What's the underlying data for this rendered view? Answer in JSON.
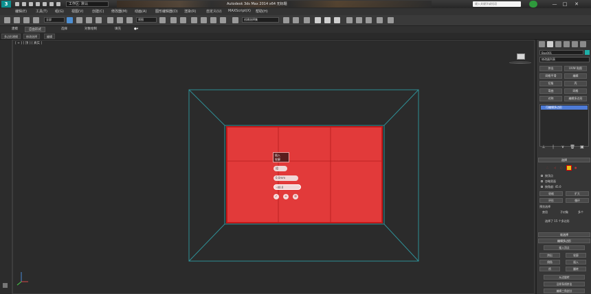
{
  "titlebar": {
    "app_logo": "3",
    "workspace": "工作区: 默认",
    "app_title": "Autodesk 3ds Max 2014 x64  无标题",
    "search_placeholder": "键入关键字或短语",
    "window_controls": [
      "—",
      "□",
      "✕"
    ]
  },
  "menu": [
    "编辑(E)",
    "工具(T)",
    "组(G)",
    "视图(V)",
    "创建(C)",
    "修改器(M)",
    "动画(A)",
    "图形编辑器(D)",
    "渲染(R)",
    "自定义(U)",
    "MAXScript(X)",
    "帮助(H)"
  ],
  "toolbar": {
    "selection_filter": "全部",
    "ref_coord": "视图",
    "named_selection": "创建选择集"
  },
  "ribbon": {
    "tabs": [
      "建模",
      "自由形式",
      "选择",
      "对象绘制",
      "填充"
    ],
    "sub_tabs": [
      "多边形建模",
      "修改选择",
      "编辑"
    ]
  },
  "viewport": {
    "label": "[ + ] [ 顶 ] [ 真实 ]"
  },
  "quad": {
    "title_lines": [
      "插入",
      "轮廓"
    ],
    "group_field": "组",
    "amount_field": "0.0mm",
    "outline_field": "-40.0"
  },
  "panel": {
    "object_name": "Box001",
    "modifier_list": "修改器列表",
    "buttons": [
      [
        "挤出",
        "UVW 贴图"
      ],
      [
        "网格平滑",
        "编辑"
      ],
      [
        "切角",
        "壳"
      ],
      [
        "弯曲",
        "网格"
      ],
      [
        "对称",
        "编辑多边形"
      ]
    ],
    "stack_item": "可编辑多边形",
    "selection_rollout": "选择",
    "by_vertex": "按顶点",
    "ignore_backfacing": "忽略背面",
    "by_angle": "按角度: 45.0",
    "shrink": "收缩",
    "grow": "扩大",
    "ring": "环形",
    "loop": "循环",
    "preview_selection": "预览选择",
    "preview_options": [
      "禁用",
      "子对象",
      "多个"
    ],
    "selected_faces": "选择了 15 个多边形",
    "soft_selection": "软选择",
    "edit_poly_rollout": "编辑多边形",
    "insert_vertex": "插入顶点",
    "extrude": "挤出",
    "outline": "轮廓",
    "bevel": "倒角",
    "inset": "插入",
    "bridge": "桥",
    "flip": "翻转",
    "hinge_from_edge": "从边旋转",
    "extrude_along_spline": "沿样条线挤出",
    "edit_triangulation": "编辑三角剖分"
  }
}
